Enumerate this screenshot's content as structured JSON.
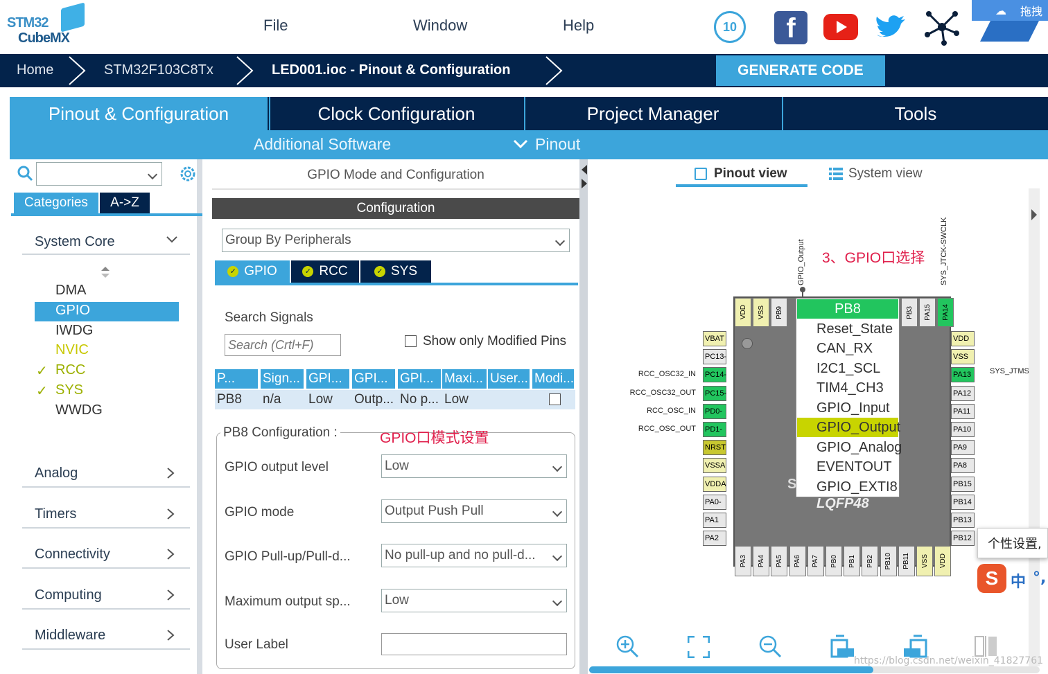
{
  "app": {
    "logo_line1": "STM32",
    "logo_line2": "CubeMX"
  },
  "menu": {
    "file": "File",
    "window": "Window",
    "help": "Help"
  },
  "top_right": {
    "drag_label": "拖拽"
  },
  "breadcrumb": {
    "home": "Home",
    "device": "STM32F103C8Tx",
    "file": "LED001.ioc - Pinout & Configuration",
    "generate": "GENERATE CODE"
  },
  "tabs": [
    "Pinout & Configuration",
    "Clock Configuration",
    "Project Manager",
    "Tools"
  ],
  "subtabs": {
    "additional": "Additional Software",
    "pinout": "Pinout"
  },
  "left": {
    "categories_tab": "Categories",
    "az_tab": "A->Z",
    "system_core": "System Core",
    "items": [
      {
        "label": "DMA",
        "color": "#333"
      },
      {
        "label": "GPIO",
        "color": "#fff"
      },
      {
        "label": "IWDG",
        "color": "#333"
      },
      {
        "label": "NVIC",
        "color": "#c8c800"
      },
      {
        "label": "RCC",
        "color": "#9cb000"
      },
      {
        "label": "SYS",
        "color": "#9cb000"
      },
      {
        "label": "WWDG",
        "color": "#333"
      }
    ],
    "groups": [
      "Analog",
      "Timers",
      "Connectivity",
      "Computing",
      "Middleware"
    ]
  },
  "mid": {
    "title": "GPIO Mode and Configuration",
    "config_header": "Configuration",
    "group_by": "Group By Peripherals",
    "periph_tabs": [
      "GPIO",
      "RCC",
      "SYS"
    ],
    "search_label": "Search Signals",
    "search_placeholder": "Search (Crtl+F)",
    "show_modified": "Show only Modified Pins",
    "table_headers": [
      "P...",
      "Sign...",
      "GPI...",
      "GPI...",
      "GPI...",
      "Maxi...",
      "User...",
      "Modi..."
    ],
    "table_row": [
      "PB8",
      "n/a",
      "Low",
      "Outp...",
      "No p...",
      "Low",
      "",
      ""
    ],
    "pin_config_title": "PB8 Configuration :",
    "annotation": "GPIO口模式设置",
    "fields": [
      {
        "label": "GPIO output level",
        "value": "Low"
      },
      {
        "label": "GPIO mode",
        "value": "Output Push Pull"
      },
      {
        "label": "GPIO Pull-up/Pull-d...",
        "value": "No pull-up and no pull-d..."
      },
      {
        "label": "Maximum output sp...",
        "value": "Low"
      }
    ],
    "user_label": "User Label"
  },
  "right": {
    "pinout_view": "Pinout view",
    "system_view": "System view",
    "annotation": "3、GPIO口选择",
    "chip_package": "LQFP48",
    "chip_letter": "S",
    "top_labels": {
      "gpio_output": "GPIO_Output",
      "swclk": "SYS_JTCK-SWCLK"
    },
    "right_label": "SYS_JTMS",
    "popup": [
      "PB8",
      "Reset_State",
      "CAN_RX",
      "I2C1_SCL",
      "TIM4_CH3",
      "GPIO_Input",
      "GPIO_Output",
      "GPIO_Analog",
      "EVENTOUT",
      "GPIO_EXTI8"
    ],
    "left_pins": [
      {
        "name": "VBAT",
        "color": "#f0f0b0",
        "signal": ""
      },
      {
        "name": "PC13-",
        "color": "#e8e8e8",
        "signal": ""
      },
      {
        "name": "PC14-",
        "color": "#22c55e",
        "signal": "RCC_OSC32_IN"
      },
      {
        "name": "PC15-",
        "color": "#22c55e",
        "signal": "RCC_OSC32_OUT"
      },
      {
        "name": "PD0-",
        "color": "#22c55e",
        "signal": "RCC_OSC_IN"
      },
      {
        "name": "PD1-",
        "color": "#22c55e",
        "signal": "RCC_OSC_OUT"
      },
      {
        "name": "NRST",
        "color": "#c8c830",
        "signal": ""
      },
      {
        "name": "VSSA",
        "color": "#f0f0b0",
        "signal": ""
      },
      {
        "name": "VDDA",
        "color": "#f0f0b0",
        "signal": ""
      },
      {
        "name": "PA0-",
        "color": "#e8e8e8",
        "signal": ""
      },
      {
        "name": "PA1",
        "color": "#e8e8e8",
        "signal": ""
      },
      {
        "name": "PA2",
        "color": "#e8e8e8",
        "signal": ""
      }
    ],
    "right_pins": [
      {
        "name": "VDD",
        "color": "#f0f0b0"
      },
      {
        "name": "VSS",
        "color": "#f0f0b0"
      },
      {
        "name": "PA13",
        "color": "#22c55e"
      },
      {
        "name": "PA12",
        "color": "#e8e8e8"
      },
      {
        "name": "PA11",
        "color": "#e8e8e8"
      },
      {
        "name": "PA10",
        "color": "#e8e8e8"
      },
      {
        "name": "PA9",
        "color": "#e8e8e8"
      },
      {
        "name": "PA8",
        "color": "#e8e8e8"
      },
      {
        "name": "PB15",
        "color": "#e8e8e8"
      },
      {
        "name": "PB14",
        "color": "#e8e8e8"
      },
      {
        "name": "PB13",
        "color": "#e8e8e8"
      },
      {
        "name": "PB12",
        "color": "#e8e8e8"
      }
    ],
    "top_pins": [
      {
        "name": "VDD",
        "color": "#f0f0b0"
      },
      {
        "name": "VSS",
        "color": "#f0f0b0"
      },
      {
        "name": "PB9",
        "color": "#e8e8e8"
      }
    ],
    "top_right_pins": [
      {
        "name": "PB3",
        "color": "#e8e8e8"
      },
      {
        "name": "PA15",
        "color": "#e8e8e8"
      },
      {
        "name": "PA14",
        "color": "#22c55e"
      }
    ],
    "bottom_pins": [
      {
        "name": "PA3",
        "color": "#e8e8e8"
      },
      {
        "name": "PA4",
        "color": "#e8e8e8"
      },
      {
        "name": "PA5",
        "color": "#e8e8e8"
      },
      {
        "name": "PA6",
        "color": "#e8e8e8"
      },
      {
        "name": "PA7",
        "color": "#e8e8e8"
      },
      {
        "name": "PB0",
        "color": "#e8e8e8"
      },
      {
        "name": "PB1",
        "color": "#e8e8e8"
      },
      {
        "name": "PB2",
        "color": "#e8e8e8"
      },
      {
        "name": "PB10",
        "color": "#e8e8e8"
      },
      {
        "name": "PB11",
        "color": "#e8e8e8"
      },
      {
        "name": "VSS",
        "color": "#f0f0b0"
      },
      {
        "name": "VDD",
        "color": "#f0f0b0"
      }
    ],
    "tooltip": "个性设置,",
    "ime": "中",
    "watermark": "https://blog.csdn.net/weixin_41827761"
  }
}
